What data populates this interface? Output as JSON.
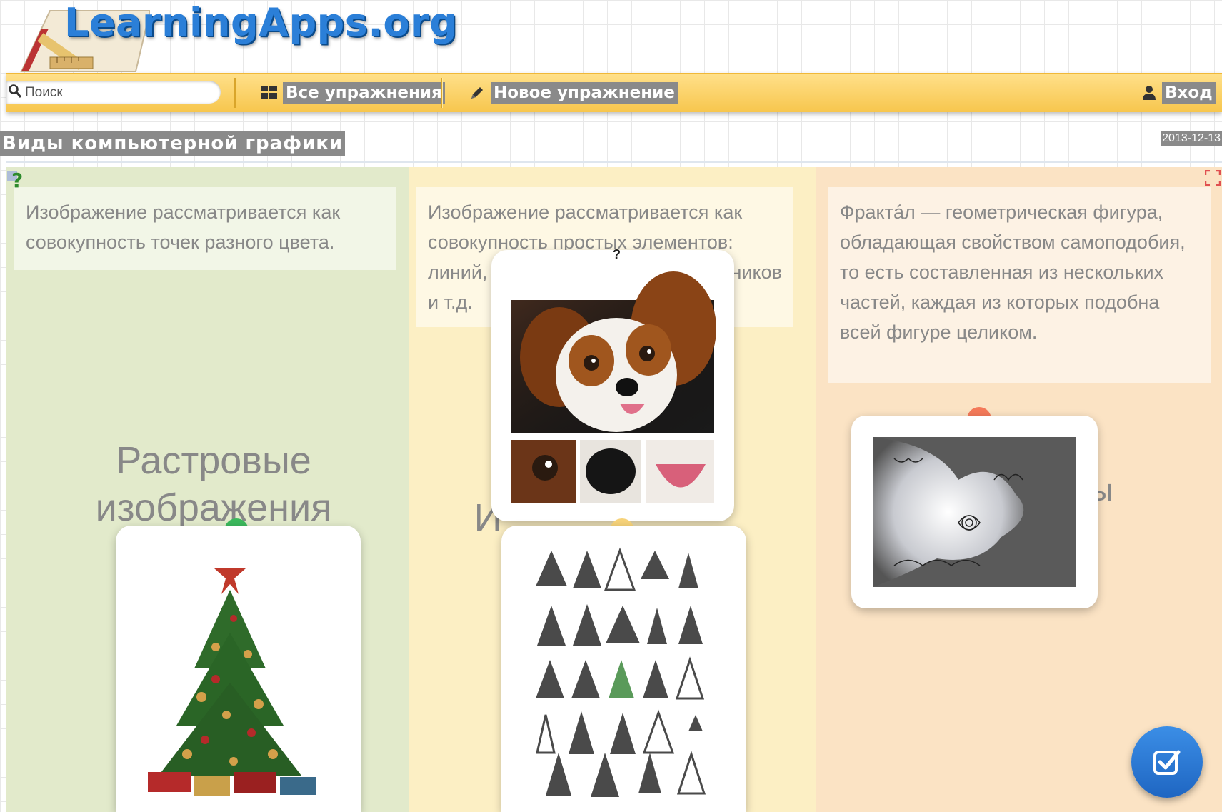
{
  "brand": {
    "logo_text": "LearningApps.org"
  },
  "navbar": {
    "search_placeholder": "Поиск",
    "all_exercises": "Все упражнения",
    "new_exercise": "Новое упражнение",
    "login": "Вход"
  },
  "page": {
    "title": "Виды компьютерной графики",
    "date": "2013-12-13"
  },
  "app": {
    "columns": [
      {
        "description": "Изображение рассматривается как совокупность точек разного цвета.",
        "label_line1": "Растровые",
        "label_line2": "изображения",
        "color": "#e2eacb",
        "pin_color": "#3cb95d"
      },
      {
        "description_line1": "Изображение рассматривается как",
        "description_line2": "совокупность простых элементов:",
        "description_line3a": "линий,",
        "description_line3b": "ников",
        "description_line4": "и т.д.",
        "label_partial": "И",
        "color": "#fcefc4",
        "pin_color": "#f7d37a"
      },
      {
        "description": "Фрактáл — геометрическая фигура, обладающая свойством самоподобия, то есть составленная из нескольких частей, каждая из которых подобна всей фигуре целиком.",
        "label_partial": "ы",
        "color": "#fbe3c4",
        "pin_color": "#f47a5a"
      }
    ],
    "hint_mark": "?"
  }
}
